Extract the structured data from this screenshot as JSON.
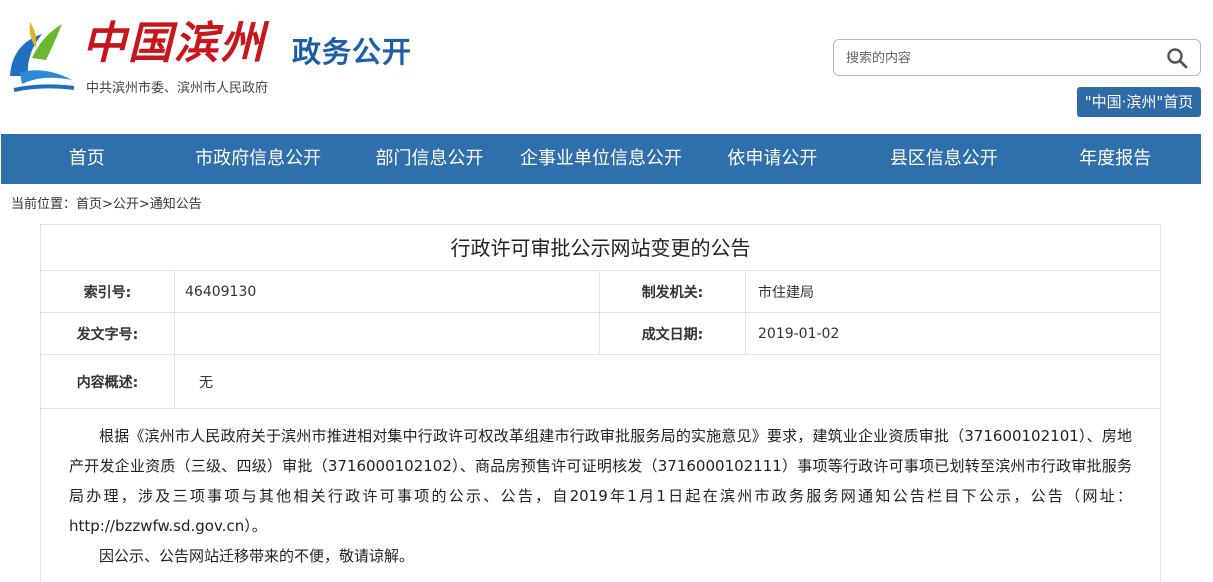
{
  "header": {
    "logo_text": "中国滨州",
    "logo_title": "政务公开",
    "logo_subtitle": "中共滨州市委、滨州市人民政府",
    "search_placeholder": "搜索的内容",
    "home_link": "\"中国·滨州\"首页",
    "colors": {
      "logo_red": "#c8161d",
      "logo_blue": "#1e5fa8"
    }
  },
  "nav": {
    "items": [
      "首页",
      "市政府信息公开",
      "部门信息公开",
      "企事业单位信息公开",
      "依申请公开",
      "县区信息公开",
      "年度报告"
    ],
    "color": "#2f6fab"
  },
  "breadcrumb": "当前位置：首页>公开>通知公告",
  "article": {
    "title": "行政许可审批公示网站变更的公告",
    "meta": {
      "index_label": "索引号:",
      "index_value": "46409130",
      "issuer_label": "制发机关:",
      "issuer_value": "市住建局",
      "docno_label": "发文字号:",
      "docno_value": "",
      "date_label": "成文日期:",
      "date_value": "2019-01-02",
      "summary_label": "内容概述:",
      "summary_value": "无"
    },
    "paragraphs": [
      "根据《滨州市人民政府关于滨州市推进相对集中行政许可权改革组建市行政审批服务局的实施意见》要求，建筑业企业资质审批（371600102101）、房地产开发企业资质（三级、四级）审批（3716000102102）、商品房预售许可证明核发（3716000102111）事项等行政许可事项已划转至滨州市行政审批服务局办理，涉及三项事项与其他相关行政许可事项的公示、公告，自2019年1月1日起在滨州市政务服务网通知公告栏目下公示，公告（网址：http://bzzwfw.sd.gov.cn）。",
      "因公示、公告网站迁移带来的不便，敬请谅解。"
    ]
  }
}
